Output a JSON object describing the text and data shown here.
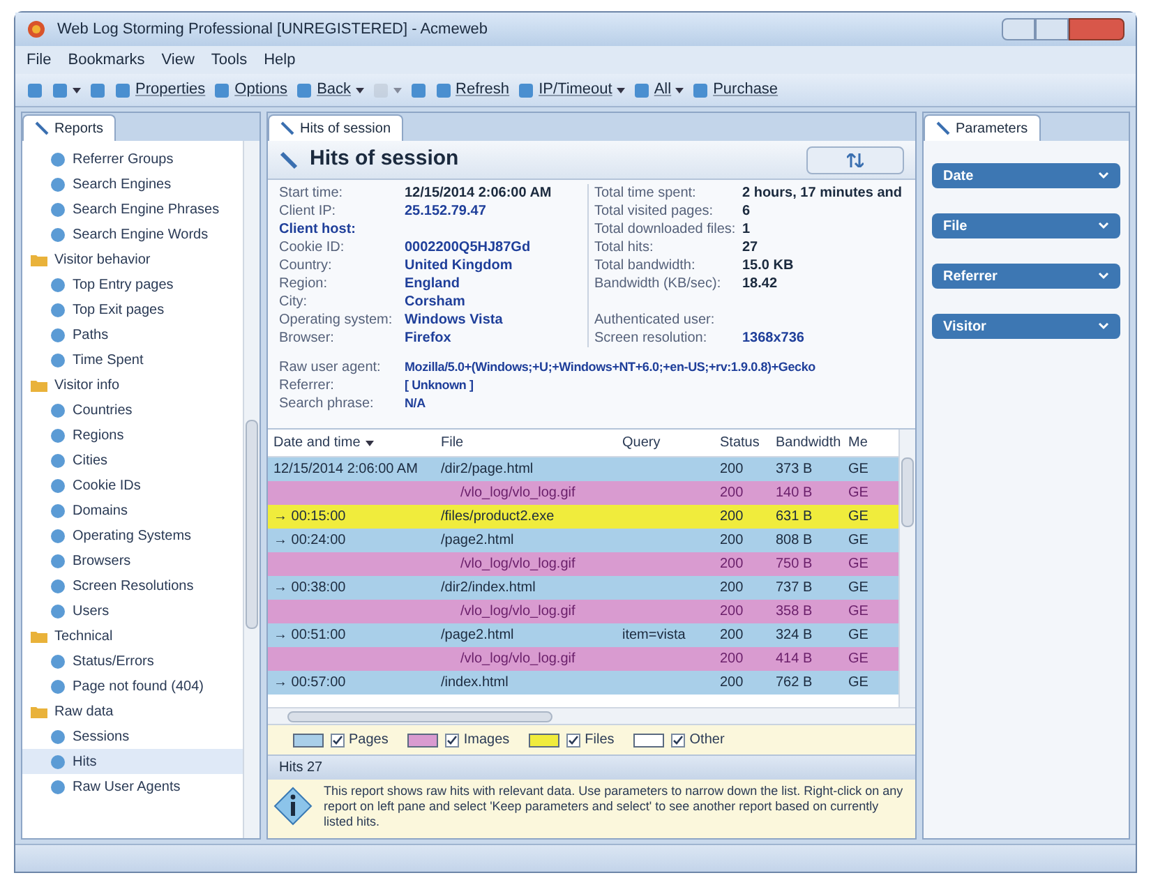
{
  "window": {
    "title": "Web Log Storming Professional [UNREGISTERED] - Acmeweb"
  },
  "menu": [
    "File",
    "Bookmarks",
    "View",
    "Tools",
    "Help"
  ],
  "toolbar": [
    {
      "caret": false,
      "disabled": false
    },
    {
      "caret": true,
      "disabled": false
    },
    {
      "caret": false,
      "disabled": false
    },
    {
      "label": "Properties",
      "caret": false,
      "disabled": false
    },
    {
      "label": "Options",
      "caret": false,
      "disabled": false
    },
    {
      "label": "Back",
      "caret": true,
      "disabled": false
    },
    {
      "caret": true,
      "disabled": true
    },
    {
      "caret": false,
      "disabled": false
    },
    {
      "label": "Refresh",
      "caret": false,
      "disabled": false
    },
    {
      "label": "IP/Timeout",
      "caret": true,
      "disabled": false
    },
    {
      "label": "All",
      "caret": true,
      "disabled": false
    },
    {
      "label": "Purchase",
      "caret": false,
      "disabled": false
    }
  ],
  "left_panel": {
    "tab": "Reports",
    "tree": [
      {
        "children": [
          {
            "label": "Referrer Groups",
            "selected": false
          },
          {
            "label": "Search Engines",
            "selected": false
          },
          {
            "label": "Search Engine Phrases",
            "selected": false
          },
          {
            "label": "Search Engine Words",
            "selected": false
          }
        ]
      },
      {
        "label": "Visitor behavior",
        "selected": false,
        "children": [
          {
            "label": "Top Entry pages",
            "selected": false
          },
          {
            "label": "Top Exit pages",
            "selected": false
          },
          {
            "label": "Paths",
            "selected": false
          },
          {
            "label": "Time Spent",
            "selected": false
          }
        ]
      },
      {
        "label": "Visitor info",
        "selected": false,
        "children": [
          {
            "label": "Countries",
            "selected": false
          },
          {
            "label": "Regions",
            "selected": false
          },
          {
            "label": "Cities",
            "selected": false
          },
          {
            "label": "Cookie IDs",
            "selected": false
          },
          {
            "label": "Domains",
            "selected": false
          },
          {
            "label": "Operating Systems",
            "selected": false
          },
          {
            "label": "Browsers",
            "selected": false
          },
          {
            "label": "Screen Resolutions",
            "selected": false
          },
          {
            "label": "Users",
            "selected": false
          }
        ]
      },
      {
        "label": "Technical",
        "selected": false,
        "children": [
          {
            "label": "Status/Errors",
            "selected": false
          },
          {
            "label": "Page not found (404)",
            "selected": false
          }
        ]
      },
      {
        "label": "Raw data",
        "selected": false,
        "children": [
          {
            "label": "Sessions",
            "selected": false
          },
          {
            "label": "Hits",
            "selected": true
          },
          {
            "label": "Raw User Agents",
            "selected": false
          }
        ]
      }
    ]
  },
  "center": {
    "tab": "Hits of session",
    "title": "Hits of session",
    "info_left": [
      {
        "label": "Start time:",
        "value": "12/15/2014 2:06:00 AM",
        "linked": false,
        "emphasized": false
      },
      {
        "label": "Client IP:",
        "value": "25.152.79.47",
        "linked": true,
        "emphasized": false
      },
      {
        "label": "Client host:",
        "emphasized": true
      },
      {
        "label": "Cookie ID:",
        "value": "0002200Q5HJ87Gd",
        "linked": true,
        "emphasized": false
      },
      {
        "label": "Country:",
        "value": "United Kingdom",
        "linked": true,
        "emphasized": false
      },
      {
        "label": "Region:",
        "value": "England",
        "linked": true,
        "emphasized": false
      },
      {
        "label": "City:",
        "value": "Corsham",
        "linked": true,
        "emphasized": false
      },
      {
        "label": "Operating system:",
        "value": "Windows Vista",
        "linked": true,
        "emphasized": false
      },
      {
        "label": "Browser:",
        "value": "Firefox",
        "linked": true,
        "emphasized": false
      }
    ],
    "info_right": [
      {
        "label": "Total time spent:",
        "value": "2 hours, 17 minutes and",
        "linked": false
      },
      {
        "label": "Total visited pages:",
        "value": "6",
        "linked": false
      },
      {
        "label": "Total downloaded files:",
        "value": "1",
        "linked": false
      },
      {
        "label": "Total hits:",
        "value": "27",
        "linked": false
      },
      {
        "label": "Total bandwidth:",
        "value": "15.0 KB",
        "linked": false
      },
      {
        "label": "Bandwidth (KB/sec):",
        "value": "18.42",
        "linked": false
      }
    ],
    "info_right_lower": [
      {
        "label": "Authenticated user:"
      },
      {
        "label": "Screen resolution:",
        "value": "1368x736",
        "linked": true
      }
    ],
    "info_bottom": [
      {
        "label": "Raw user agent:",
        "value": "Mozilla/5.0+(Windows;+U;+Windows+NT+6.0;+en-US;+rv:1.9.0.8)+Gecko"
      },
      {
        "label": "Referrer:",
        "value": "[ Unknown ]"
      },
      {
        "label": "Search phrase:",
        "value": "N/A"
      }
    ],
    "table": {
      "columns": [
        "Date and time",
        "File",
        "Query",
        "Status",
        "Bandwidth",
        "Me"
      ],
      "rows": [
        {
          "kind": "page",
          "cells": [
            "12/15/2014 2:06:00 AM",
            "/dir2/page.html",
            "",
            "200",
            "373 B",
            "GE"
          ]
        },
        {
          "kind": "image",
          "cells": [
            "",
            "/vlo_log/vlo_log.gif",
            "",
            "200",
            "140 B",
            "GE"
          ]
        },
        {
          "kind": "file",
          "cells": [
            "→ 00:15:00",
            "/files/product2.exe",
            "",
            "200",
            "631 B",
            "GE"
          ]
        },
        {
          "kind": "page",
          "cells": [
            "→ 00:24:00",
            "/page2.html",
            "",
            "200",
            "808 B",
            "GE"
          ]
        },
        {
          "kind": "image",
          "cells": [
            "",
            "/vlo_log/vlo_log.gif",
            "",
            "200",
            "750 B",
            "GE"
          ]
        },
        {
          "kind": "page",
          "cells": [
            "→ 00:38:00",
            "/dir2/index.html",
            "",
            "200",
            "737 B",
            "GE"
          ]
        },
        {
          "kind": "image",
          "cells": [
            "",
            "/vlo_log/vlo_log.gif",
            "",
            "200",
            "358 B",
            "GE"
          ]
        },
        {
          "kind": "page",
          "cells": [
            "→ 00:51:00",
            "/page2.html",
            "item=vista",
            "200",
            "324 B",
            "GE"
          ]
        },
        {
          "kind": "image",
          "cells": [
            "",
            "/vlo_log/vlo_log.gif",
            "",
            "200",
            "414 B",
            "GE"
          ]
        },
        {
          "kind": "page",
          "cells": [
            "→ 00:57:00",
            "/index.html",
            "",
            "200",
            "762 B",
            "GE"
          ]
        }
      ]
    },
    "legend": [
      {
        "label": "Pages",
        "color": "#a9cfe9",
        "checked": true
      },
      {
        "label": "Images",
        "color": "#d99bd0",
        "checked": true
      },
      {
        "label": "Files",
        "color": "#f0ec3c",
        "checked": true
      },
      {
        "label": "Other",
        "color": "#ffffff",
        "checked": true
      }
    ],
    "summary": "Hits 27",
    "message": "This report shows raw hits with relevant data. Use parameters to narrow down the list. Right-click on any report on left pane and select 'Keep parameters and select' to see another report based on currently listed hits."
  },
  "right_panel": {
    "tab": "Parameters",
    "groups": [
      "Date",
      "File",
      "Referrer",
      "Visitor"
    ]
  }
}
